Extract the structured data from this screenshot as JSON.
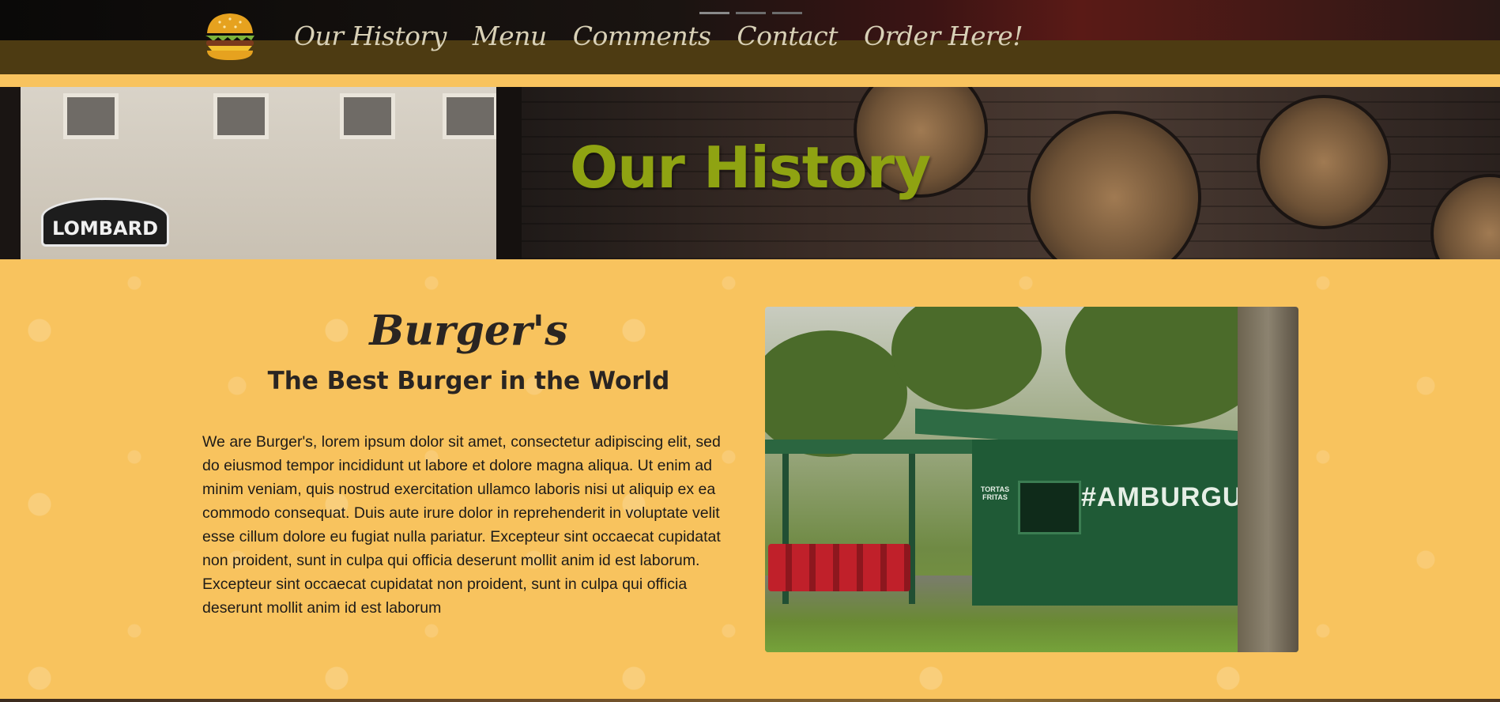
{
  "nav": {
    "links": [
      "Our History",
      "Menu",
      "Comments",
      "Contact",
      "Order Here!"
    ],
    "logo_icon": "burger-icon"
  },
  "hero": {
    "title": "Our History",
    "sign_text": "LOMBARD"
  },
  "about": {
    "brand": "Burger's",
    "tagline": "The Best Burger in the World",
    "description": "We are Burger's, lorem ipsum dolor sit amet, consectetur adipiscing elit, sed do eiusmod tempor incididunt ut labore et dolore magna aliqua. Ut enim ad minim veniam, quis nostrud exercitation ullamco laboris nisi ut aliquip ex ea commodo consequat. Duis aute irure dolor in reprehenderit in voluptate velit esse cillum dolore eu fugiat nulla pariatur. Excepteur sint occaecat cupidatat non proident, sunt in culpa qui officia deserunt mollit anim id est laborum. Excepteur sint occaecat cupidatat non proident, sunt in culpa qui officia deserunt mollit anim id est laborum",
    "photo_sign": "#AMBURGUESAS",
    "photo_small_sign": "TORTAS FRITAS"
  },
  "colors": {
    "accent_yellow": "#f8c35e",
    "hero_title_green": "#8fa312",
    "nav_band": "#4d3b12"
  }
}
